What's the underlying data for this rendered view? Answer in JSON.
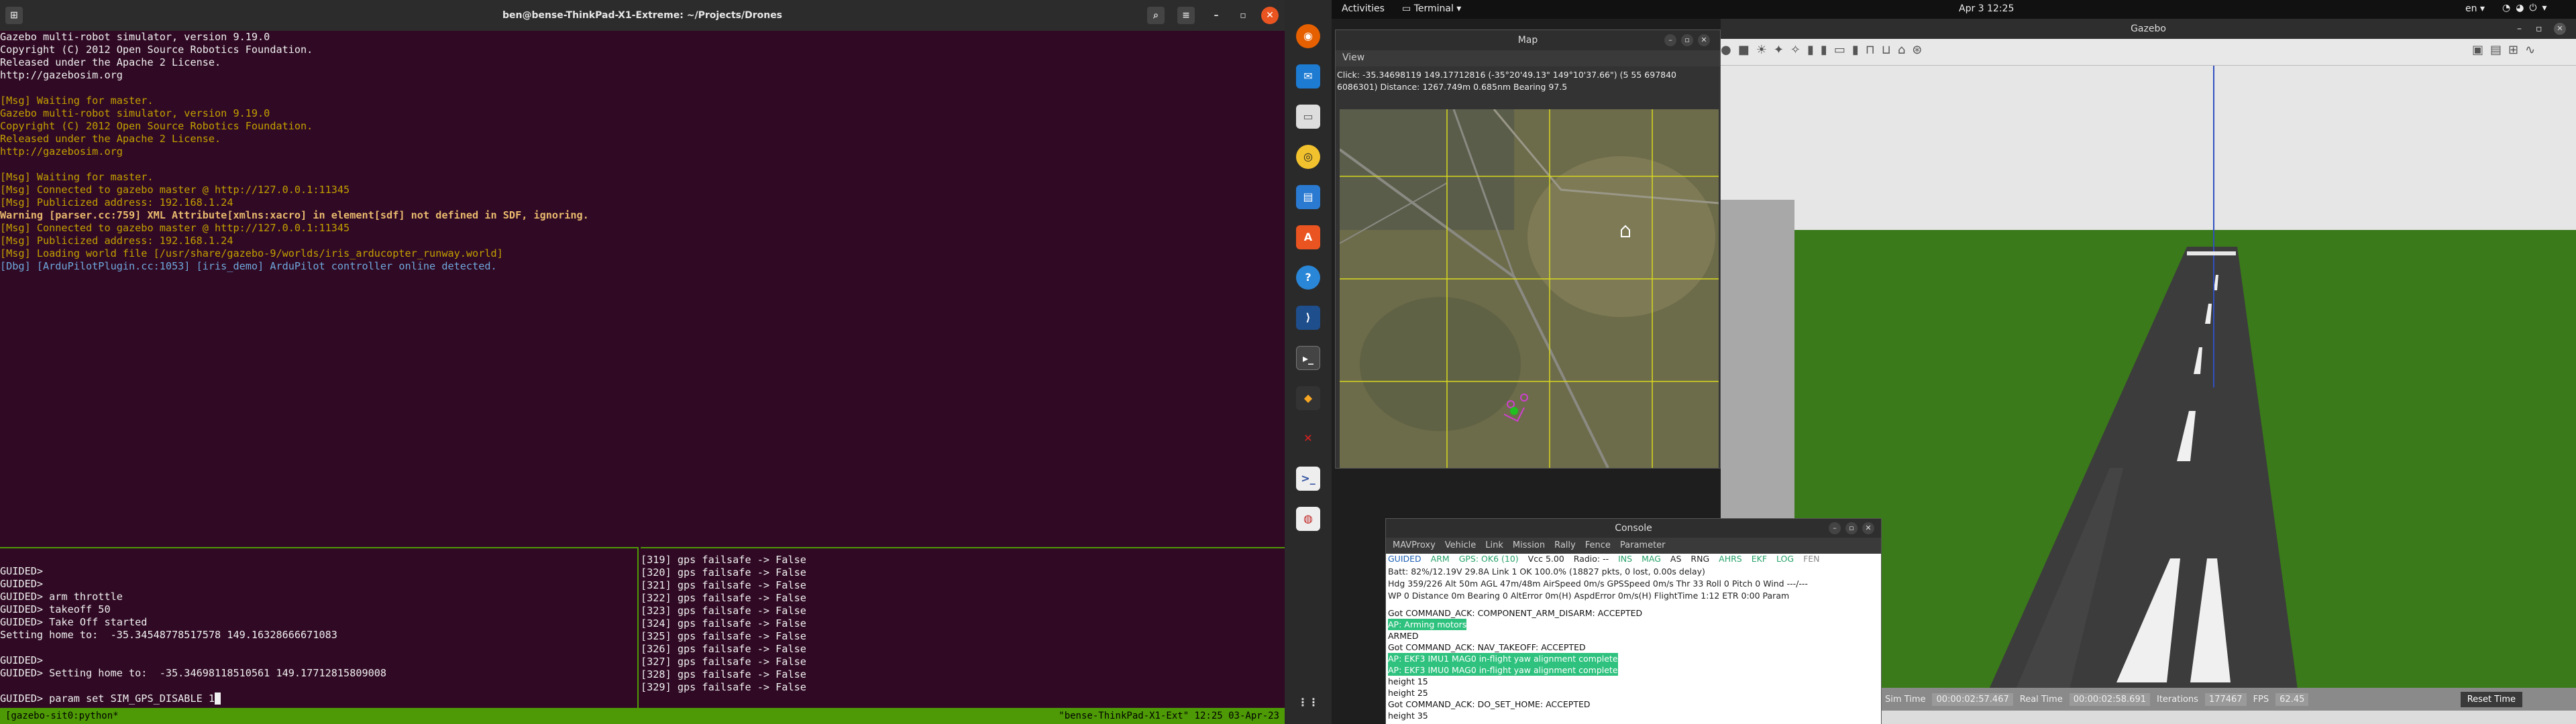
{
  "terminal": {
    "title": "ben@bense-ThinkPad-X1-Extreme: ~/Projects/Drones",
    "output": [
      {
        "c": "w",
        "t": "Gazebo multi-robot simulator, version 9.19.0"
      },
      {
        "c": "w",
        "t": "Copyright (C) 2012 Open Source Robotics Foundation."
      },
      {
        "c": "w",
        "t": "Released under the Apache 2 License."
      },
      {
        "c": "w",
        "t": "http://gazebosim.org"
      },
      {
        "c": "w",
        "t": ""
      },
      {
        "c": "y",
        "t": "[Msg] Waiting for master."
      },
      {
        "c": "y",
        "t": "Gazebo multi-robot simulator, version 9.19.0"
      },
      {
        "c": "y",
        "t": "Copyright (C) 2012 Open Source Robotics Foundation."
      },
      {
        "c": "y",
        "t": "Released under the Apache 2 License."
      },
      {
        "c": "y",
        "t": "http://gazebosim.org"
      },
      {
        "c": "w",
        "t": ""
      },
      {
        "c": "y",
        "t": "[Msg] Waiting for master."
      },
      {
        "c": "y",
        "t": "[Msg] Connected to gazebo master @ http://127.0.0.1:11345"
      },
      {
        "c": "y",
        "t": "[Msg] Publicized address: 192.168.1.24"
      },
      {
        "c": "o",
        "t": "Warning [parser.cc:759] XML Attribute[xmlns:xacro] in element[sdf] not defined in SDF, ignoring."
      },
      {
        "c": "y",
        "t": "[Msg] Connected to gazebo master @ http://127.0.0.1:11345"
      },
      {
        "c": "y",
        "t": "[Msg] Publicized address: 192.168.1.24"
      },
      {
        "c": "y",
        "t": "[Msg] Loading world file [/usr/share/gazebo-9/worlds/iris_arducopter_runway.world]"
      },
      {
        "c": "b",
        "t": "[Dbg] [ArduPilotPlugin.cc:1053] [iris_demo] ArduPilot controller online detected."
      }
    ],
    "left_pane": [
      "GUIDED>",
      "GUIDED>",
      "GUIDED> arm throttle",
      "GUIDED> takeoff 50",
      "GUIDED> Take Off started",
      "Setting home to:  -35.34548778517578 149.16328666671083",
      "",
      "GUIDED>",
      "GUIDED> Setting home to:  -35.34698118510561 149.17712815809008",
      "",
      "GUIDED> param set SIM_GPS_DISABLE 1"
    ],
    "right_pane": [
      "[319] gps failsafe -> False",
      "[320] gps failsafe -> False",
      "[321] gps failsafe -> False",
      "[322] gps failsafe -> False",
      "[323] gps failsafe -> False",
      "[324] gps failsafe -> False",
      "[325] gps failsafe -> False",
      "[326] gps failsafe -> False",
      "[327] gps failsafe -> False",
      "[328] gps failsafe -> False",
      "[329] gps failsafe -> False"
    ],
    "status_left": "[gazebo-sit0:python*",
    "status_right": "\"bense-ThinkPad-X1-Ext\" 12:25 03-Apr-23"
  },
  "topbar": {
    "activities": "Activities",
    "app": "Terminal",
    "datetime": "Apr 3  12:25",
    "lang": "en"
  },
  "map": {
    "title": "Map",
    "menu": "View",
    "info1": "Click: -35.34698119 149.17712816 (-35°20'49.13\" 149°10'37.66\") (5 55 697840",
    "info2": "6086301)  Distance: 1267.749m 0.685nm Bearing 97.5"
  },
  "gazebo": {
    "title": "Gazebo",
    "sim_time_label": "Sim Time",
    "sim_time": "00:00:02:57.467",
    "real_time_label": "Real Time",
    "real_time": "00:00:02:58.691",
    "iterations_label": "Iterations",
    "iterations": "177467",
    "fps_label": "FPS",
    "fps": "62.45",
    "reset": "Reset Time"
  },
  "console": {
    "title": "Console",
    "menu": [
      "MAVProxy",
      "Vehicle",
      "Link",
      "Mission",
      "Rally",
      "Fence",
      "Parameter"
    ],
    "status1": [
      "GUIDED",
      "ARM",
      "GPS: OK6 (10)",
      "Vcc 5.00",
      "Radio: --",
      "INS",
      "MAG",
      "AS",
      "RNG",
      "AHRS",
      "EKF",
      "LOG",
      "FEN"
    ],
    "status2": "Batt: 82%/12.19V 29.8A    Link 1 OK 100.0% (18827 pkts, 0 lost, 0.00s delay)",
    "status3": "Hdg 359/226    Alt 50m    AGL 47m/48m    AirSpeed 0m/s    GPSSpeed 0m/s    Thr 33    Roll 0    Pitch 0    Wind ---/---",
    "status4": "WP 0    Distance 0m    Bearing 0    AltError 0m(H)    AspdError 0m/s(H)    FlightTime 1:12    ETR 0:00    Param",
    "log": [
      {
        "c": "n",
        "t": "Got COMMAND_ACK: COMPONENT_ARM_DISARM: ACCEPTED"
      },
      {
        "c": "g",
        "t": "AP: Arming motors"
      },
      {
        "c": "n",
        "t": "ARMED"
      },
      {
        "c": "n",
        "t": "Got COMMAND_ACK: NAV_TAKEOFF: ACCEPTED"
      },
      {
        "c": "g",
        "t": "AP: EKF3 IMU1 MAG0 in-flight yaw alignment complete"
      },
      {
        "c": "g",
        "t": "AP: EKF3 IMU0 MAG0 in-flight yaw alignment complete"
      },
      {
        "c": "n",
        "t": "height 15"
      },
      {
        "c": "n",
        "t": "height 25"
      },
      {
        "c": "n",
        "t": "Got COMMAND_ACK: DO_SET_HOME: ACCEPTED"
      },
      {
        "c": "n",
        "t": "height 35"
      }
    ]
  },
  "colors": {
    "terminal_bg": "#300a24",
    "tmux_green": "#4e9a06",
    "grass": "#3a7a1a",
    "runway": "#3c3c3c"
  }
}
